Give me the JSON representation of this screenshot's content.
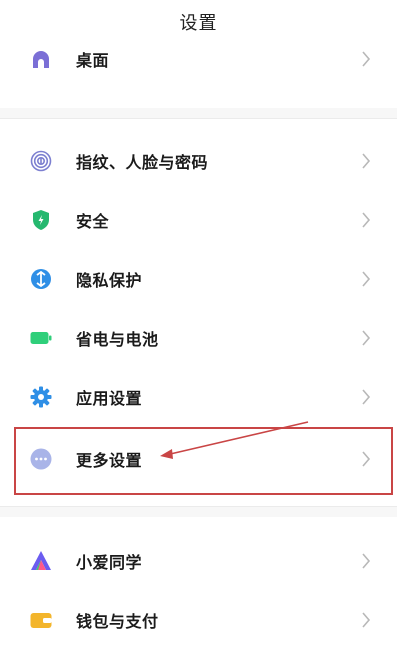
{
  "header": {
    "title": "设置"
  },
  "groups": [
    {
      "items": [
        {
          "label": "桌面",
          "icon": "home-icon",
          "color": "#7b6fd6"
        }
      ]
    },
    {
      "items": [
        {
          "label": "指纹、人脸与密码",
          "icon": "fingerprint-icon",
          "color": "#7c7fd0"
        },
        {
          "label": "安全",
          "icon": "shield-icon",
          "color": "#25b86f"
        },
        {
          "label": "隐私保护",
          "icon": "privacy-icon",
          "color": "#2f8fe6"
        },
        {
          "label": "省电与电池",
          "icon": "battery-icon",
          "color": "#2fcf7a"
        },
        {
          "label": "应用设置",
          "icon": "gear-icon",
          "color": "#2f8fe6"
        },
        {
          "label": "更多设置",
          "icon": "more-icon",
          "color": "#a9b4e8"
        }
      ]
    },
    {
      "items": [
        {
          "label": "小爱同学",
          "icon": "xiaoai-icon",
          "color": "#6b5cf0"
        },
        {
          "label": "钱包与支付",
          "icon": "wallet-icon",
          "color": "#f3b52b"
        }
      ]
    }
  ],
  "annotation": {
    "highlight_color": "#c94545",
    "highlighted_item": "更多设置"
  }
}
